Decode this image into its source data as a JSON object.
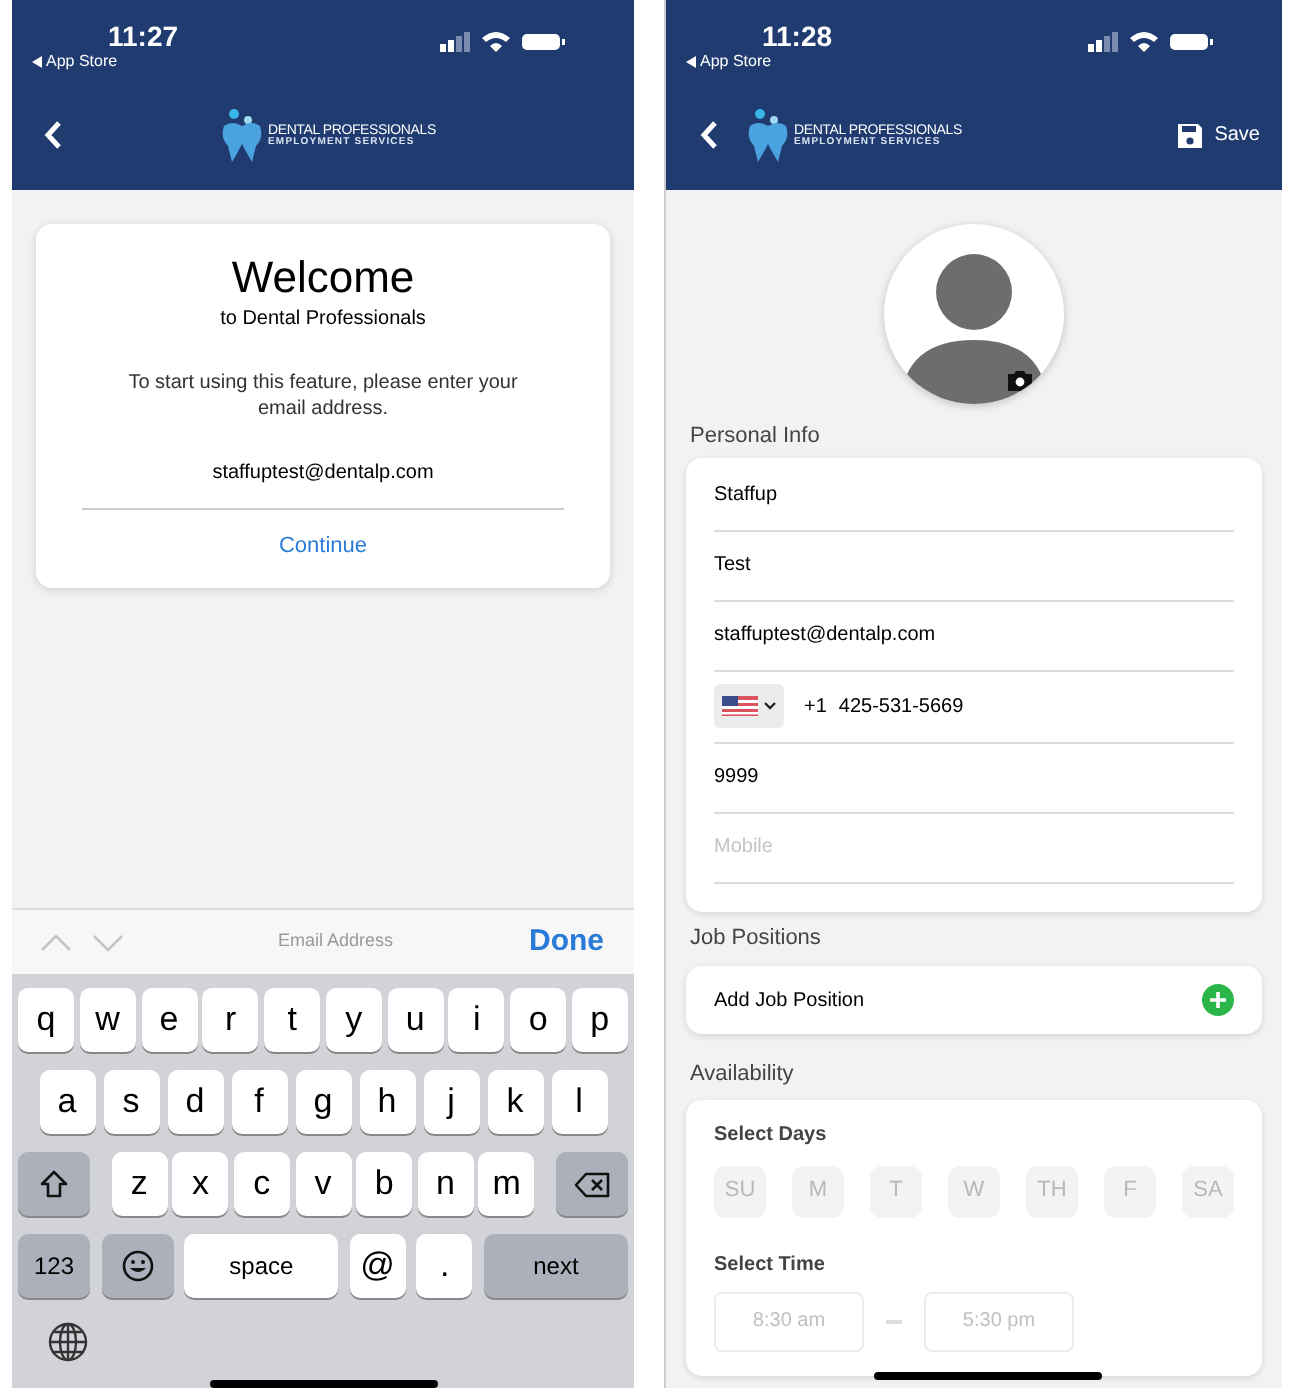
{
  "left_screen": {
    "status_bar": {
      "time": "11:27",
      "back_label": "App Store"
    },
    "logo": {
      "line1": "DENTAL PROFESSIONALS",
      "line2": "EMPLOYMENT SERVICES"
    },
    "welcome_card": {
      "title": "Welcome",
      "subtitle": "to Dental Professionals",
      "message": "To start using this feature, please enter your email address.",
      "email": "staffuptest@dentalp.com",
      "action": "Continue"
    },
    "keyboard_toolbar": {
      "previous_disabled": true,
      "next_disabled": true,
      "field_label": "Email Address",
      "done": "Done"
    },
    "keyboard": {
      "rows": [
        {
          "keys": [
            {
              "kind": "letter",
              "label": "q"
            },
            {
              "kind": "letter",
              "label": "w"
            },
            {
              "kind": "letter",
              "label": "e"
            },
            {
              "kind": "letter",
              "label": "r"
            },
            {
              "kind": "letter",
              "label": "t"
            },
            {
              "kind": "letter",
              "label": "y"
            },
            {
              "kind": "letter",
              "label": "u"
            },
            {
              "kind": "letter",
              "label": "i"
            },
            {
              "kind": "letter",
              "label": "o"
            },
            {
              "kind": "letter",
              "label": "p"
            }
          ]
        },
        {
          "keys": [
            {
              "kind": "letter",
              "label": "a"
            },
            {
              "kind": "letter",
              "label": "s"
            },
            {
              "kind": "letter",
              "label": "d"
            },
            {
              "kind": "letter",
              "label": "f"
            },
            {
              "kind": "letter",
              "label": "g"
            },
            {
              "kind": "letter",
              "label": "h"
            },
            {
              "kind": "letter",
              "label": "j"
            },
            {
              "kind": "letter",
              "label": "k"
            },
            {
              "kind": "letter",
              "label": "l"
            }
          ]
        },
        {
          "keys": [
            {
              "kind": "shift"
            },
            {
              "kind": "letter",
              "label": "z"
            },
            {
              "kind": "letter",
              "label": "x"
            },
            {
              "kind": "letter",
              "label": "c"
            },
            {
              "kind": "letter",
              "label": "v"
            },
            {
              "kind": "letter",
              "label": "b"
            },
            {
              "kind": "letter",
              "label": "n"
            },
            {
              "kind": "letter",
              "label": "m"
            },
            {
              "kind": "backspace"
            }
          ]
        },
        {
          "keys": [
            {
              "kind": "function",
              "label": "123"
            },
            {
              "kind": "emoji"
            },
            {
              "kind": "space",
              "label": "space"
            },
            {
              "kind": "letter",
              "label": "@"
            },
            {
              "kind": "letter",
              "label": "."
            },
            {
              "kind": "return",
              "label": "next"
            }
          ]
        }
      ]
    }
  },
  "right_screen": {
    "status_bar": {
      "time": "11:28",
      "back_label": "App Store"
    },
    "logo": {
      "line1": "DENTAL PROFESSIONALS",
      "line2": "EMPLOYMENT SERVICES"
    },
    "save": "Save",
    "personal_info": {
      "title": "Personal Info",
      "fields": [
        {
          "kind": "text",
          "value": "Staffup"
        },
        {
          "kind": "text",
          "value": "Test"
        },
        {
          "kind": "text",
          "value": "staffuptest@dentalp.com"
        },
        {
          "kind": "phone",
          "code": "+1",
          "value": "425-531-5669"
        },
        {
          "kind": "text",
          "value": "9999"
        },
        {
          "kind": "text",
          "placeholder": "Mobile"
        }
      ]
    },
    "job_positions": {
      "title": "Job Positions",
      "add": "Add Job Position"
    },
    "availability": {
      "title": "Availability",
      "days_label": "Select Days",
      "days": [
        {
          "label": "SU",
          "selected": false
        },
        {
          "label": "M",
          "selected": false
        },
        {
          "label": "T",
          "selected": false
        },
        {
          "label": "W",
          "selected": false
        },
        {
          "label": "TH",
          "selected": false
        },
        {
          "label": "F",
          "selected": false
        },
        {
          "label": "SA",
          "selected": false
        }
      ],
      "time_label": "Select Time",
      "start": "8:30 am",
      "end": "5:30 pm"
    }
  }
}
